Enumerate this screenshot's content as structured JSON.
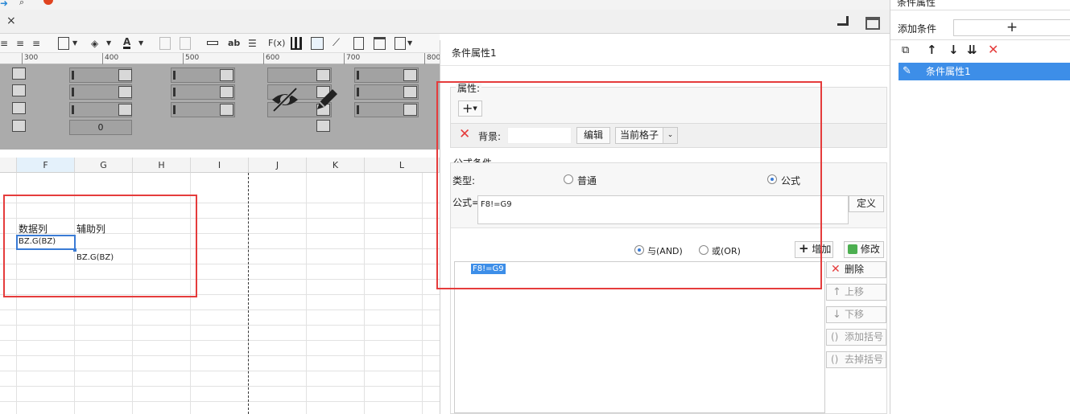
{
  "right_panel": {
    "header_title": "条件属性",
    "add_condition_label": "添加条件",
    "add_symbol": "+",
    "selected_item": "条件属性1"
  },
  "dialog": {
    "title": "条件属性1",
    "property_section_label": "属性:",
    "add_property_symbol": "+",
    "property_row": {
      "label": "背景:",
      "edit_button": "编辑",
      "scope_select": "当前格子"
    },
    "formula_section_label": "公式条件",
    "type_label": "类型:",
    "type_options": [
      "普通",
      "公式"
    ],
    "type_selected": "公式",
    "formula_label": "公式=",
    "formula_value": "F8!=G9",
    "define_button": "定义",
    "logic_options": [
      "与(AND)",
      "或(OR)"
    ],
    "logic_selected": "与(AND)",
    "add_button": "增加",
    "modify_button": "修改",
    "conditions": [
      "F8!=G9"
    ],
    "side_buttons": [
      "删除",
      "上移",
      "下移",
      "添加括号",
      "去掉括号"
    ]
  },
  "sheet": {
    "ruler_marks": [
      "300",
      "400",
      "500",
      "600",
      "700",
      "800"
    ],
    "columns": [
      "F",
      "G",
      "H",
      "I",
      "J",
      "K",
      "L"
    ],
    "cells": {
      "F_header": "数据列",
      "G_header": "辅助列",
      "F_value": "BZ.G(BZ)",
      "G_value": "BZ.G(BZ)"
    },
    "widget_value": "0"
  },
  "colors": {
    "accent": "#3d8ee8",
    "highlight": "#e53c3c",
    "selection": "#3a7bd5"
  }
}
